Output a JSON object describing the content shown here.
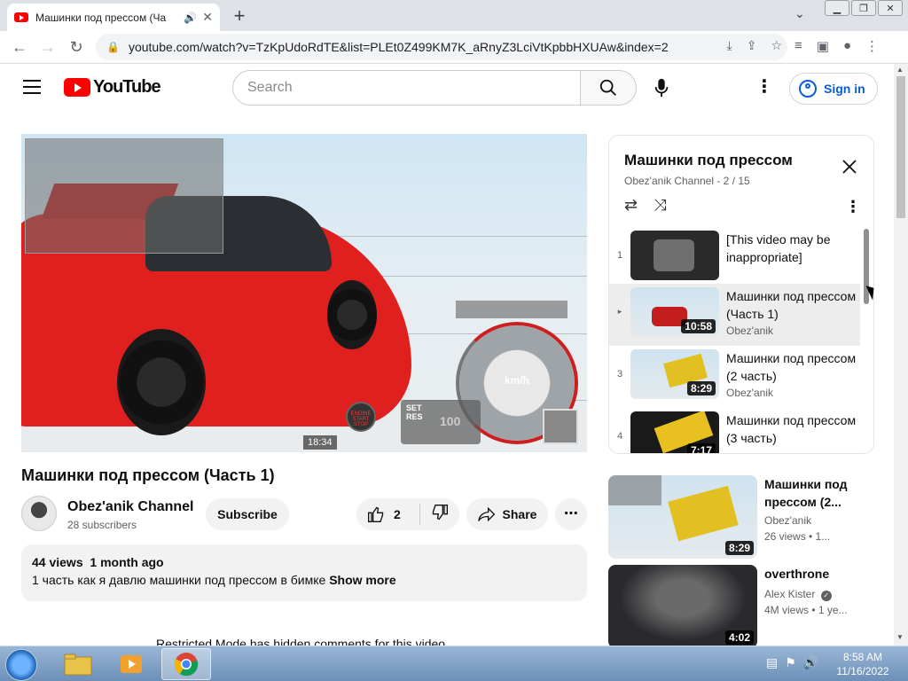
{
  "browser": {
    "tab_title": "Машинки под прессом (Ча",
    "url": "youtube.com/watch?v=TzKpUdoRdTE&list=PLEt0Z499KM7K_aRnyZ3LciVtKpbbHXUAw&index=2"
  },
  "header": {
    "logo_text": "YouTube",
    "search_placeholder": "Search",
    "signin_label": "Sign in"
  },
  "player": {
    "timestamp": "18:34",
    "speed_unit": "km/h",
    "cruise_set": "SET",
    "cruise_res": "RES",
    "cruise_value": "100",
    "start_label": "ENGINE START STOP"
  },
  "video": {
    "title": "Машинки под прессом (Часть 1)",
    "channel_name": "Obez'anik Channel",
    "subscribers": "28 subscribers",
    "subscribe_label": "Subscribe",
    "likes": "2",
    "share_label": "Share",
    "views": "44 views",
    "date": "1 month ago",
    "description": "1 часть как я давлю машинки под прессом в бимке",
    "show_more": "Show more",
    "restricted_notice": "Restricted Mode has hidden comments for this video."
  },
  "playlist": {
    "title": "Машинки под прессом",
    "subtitle": "Obez'anik Channel - 2 / 15",
    "items": [
      {
        "index": "1",
        "title": "[This video may be inappropriate]",
        "channel": "",
        "duration": ""
      },
      {
        "index": "▸",
        "title": "Машинки под прессом (Часть 1)",
        "channel": "Obez'anik",
        "duration": "10:58"
      },
      {
        "index": "3",
        "title": "Машинки под прессом (2 часть)",
        "channel": "Obez'anik",
        "duration": "8:29"
      },
      {
        "index": "4",
        "title": "Машинки под прессом (3 часть)",
        "channel": "",
        "duration": "7:17"
      }
    ]
  },
  "recommendations": [
    {
      "title": "Машинки под прессом (2...",
      "channel": "Obez'anik",
      "meta": "26 views • 1...",
      "duration": "8:29"
    },
    {
      "title": "overthrone",
      "channel": "Alex Kister",
      "meta": "4M views • 1 ye...",
      "duration": "4:02"
    }
  ],
  "taskbar": {
    "time": "8:58 AM",
    "date": "11/16/2022"
  },
  "colors": {
    "yt_red": "#ff0000",
    "link_blue": "#065fd4",
    "taskbar": "#6c8fb8"
  }
}
